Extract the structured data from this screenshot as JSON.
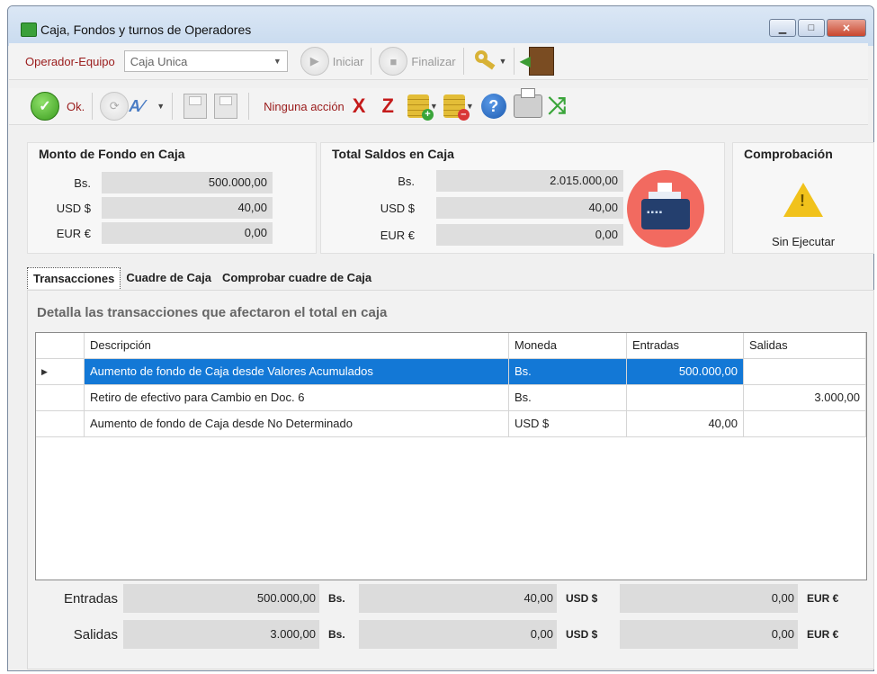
{
  "window": {
    "title": "Caja, Fondos y turnos de Operadores",
    "controls": [
      "minimize",
      "maximize",
      "close"
    ]
  },
  "toolbar1": {
    "operator_label": "Operador-Equipo",
    "combo_value": "Caja Unica",
    "start_label": "Iniciar",
    "finish_label": "Finalizar"
  },
  "toolbar2": {
    "ok_label": "Ok.",
    "action_text": "Ninguna acción",
    "x_label": "X",
    "z_label": "Z",
    "help_glyph": "?"
  },
  "fondo": {
    "title": "Monto de Fondo en Caja",
    "rows": [
      {
        "currency": "Bs.",
        "value": "500.000,00"
      },
      {
        "currency": "USD $",
        "value": "40,00"
      },
      {
        "currency": "EUR €",
        "value": "0,00"
      }
    ]
  },
  "saldos": {
    "title": "Total Saldos en Caja",
    "rows": [
      {
        "currency": "Bs.",
        "value": "2.015.000,00"
      },
      {
        "currency": "USD $",
        "value": "40,00"
      },
      {
        "currency": "EUR €",
        "value": "0,00"
      }
    ]
  },
  "comprobacion": {
    "title": "Comprobación",
    "status": "Sin Ejecutar"
  },
  "tabs": [
    {
      "label": "Transacciones",
      "active": true
    },
    {
      "label": "Cuadre de Caja",
      "active": false
    },
    {
      "label": "Comprobar cuadre de Caja",
      "active": false
    }
  ],
  "transactions": {
    "description": "Detalla las transacciones que afectaron el total en caja",
    "columns": [
      "Descripción",
      "Moneda",
      "Entradas",
      "Salidas"
    ],
    "rows": [
      {
        "desc": "Aumento de fondo de Caja desde Valores Acumulados",
        "currency": "Bs.",
        "in": "500.000,00",
        "out": ""
      },
      {
        "desc": "Retiro de efectivo para Cambio en Doc. 6",
        "currency": "Bs.",
        "in": "",
        "out": "3.000,00"
      },
      {
        "desc": "Aumento de fondo de Caja desde No Determinado",
        "currency": "USD $",
        "in": "40,00",
        "out": ""
      }
    ]
  },
  "totals": {
    "entradas_label": "Entradas",
    "salidas_label": "Salidas",
    "entradas": [
      "500.000,00",
      "40,00",
      "0,00"
    ],
    "salidas": [
      "3.000,00",
      "0,00",
      "0,00"
    ],
    "currencies": [
      "Bs.",
      "USD $",
      "EUR €"
    ]
  },
  "colors": {
    "selection": "#1378d6",
    "accent_red": "#9a1b1b"
  }
}
